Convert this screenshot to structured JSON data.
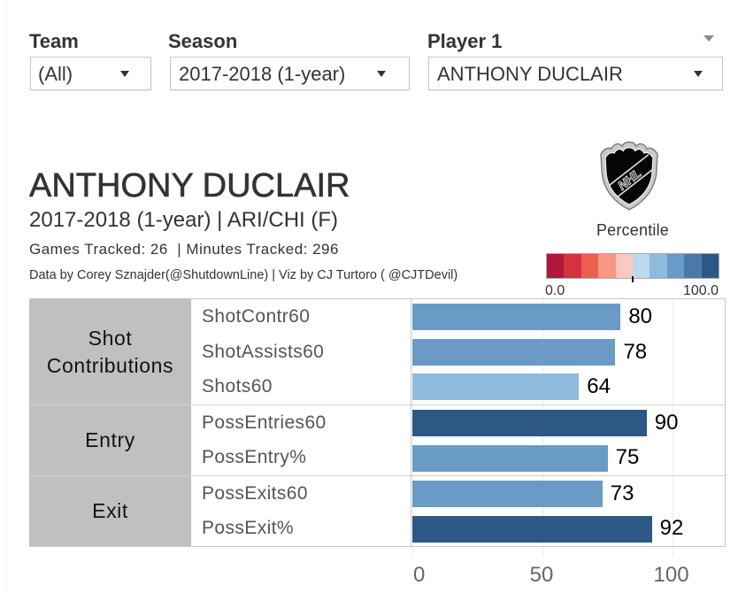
{
  "filters": {
    "team": {
      "label": "Team",
      "value": "(All)"
    },
    "season": {
      "label": "Season",
      "value": "2017-2018 (1-year)"
    },
    "player1": {
      "label": "Player 1",
      "value": "ANTHONY DUCLAIR"
    }
  },
  "icons": {
    "dropdown_caret": "caret-down-icon",
    "logo": "nhl-shield-logo"
  },
  "header": {
    "player_name": "ANTHONY DUCLAIR",
    "subtitle": "2017-2018 (1-year) | ARI/CHI (F)",
    "tracking": "Games Tracked: 26  | Minutes Tracked: 296",
    "credits": "Data by Corey Sznajder(@ShutdownLine) | Viz by CJ Turtoro ( @CJTDevil)"
  },
  "logo": {
    "text": "NHL"
  },
  "legend": {
    "title": "Percentile",
    "min_label": "0.0",
    "max_label": "100.0",
    "center_marker": 50,
    "colors": [
      "#b0163a",
      "#d7303f",
      "#ec5f4f",
      "#f79a83",
      "#fcc8c2",
      "#bcd9ee",
      "#8fbbdc",
      "#6a9bc6",
      "#4a79a9",
      "#2d5886"
    ]
  },
  "chart_data": {
    "type": "bar",
    "orientation": "horizontal",
    "title": "ANTHONY DUCLAIR",
    "xlabel": "",
    "ylabel": "",
    "xlim": [
      0,
      120
    ],
    "xticks": [
      0,
      50,
      100
    ],
    "tick_labels": [
      "0",
      "50",
      "100"
    ],
    "grid": true,
    "legend": "top-right",
    "groups": [
      {
        "name": "Shot Contributions",
        "metrics": [
          "ShotContr60",
          "ShotAssists60",
          "Shots60"
        ]
      },
      {
        "name": "Entry",
        "metrics": [
          "PossEntries60",
          "PossEntry%"
        ]
      },
      {
        "name": "Exit",
        "metrics": [
          "PossExits60",
          "PossExit%"
        ]
      }
    ],
    "categories": [
      "ShotContr60",
      "ShotAssists60",
      "Shots60",
      "PossEntries60",
      "PossEntry%",
      "PossExits60",
      "PossExit%"
    ],
    "values": [
      80,
      78,
      64,
      90,
      75,
      73,
      92
    ],
    "data_labels": [
      "80",
      "78",
      "64",
      "90",
      "75",
      "73",
      "92"
    ],
    "colors": [
      "#6a9bc6",
      "#6a9bc6",
      "#8fbbdc",
      "#2d5886",
      "#6a9bc6",
      "#6a9bc6",
      "#2d5886"
    ]
  }
}
